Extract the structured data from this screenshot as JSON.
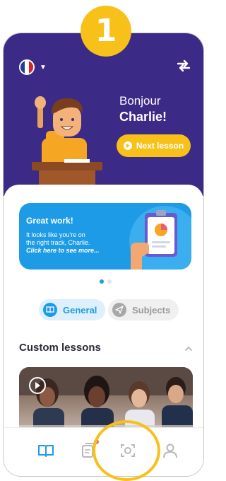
{
  "step_badge": "1",
  "header": {
    "language_flag": "france-flag-icon",
    "greeting": "Bonjour",
    "name": "Charlie!",
    "next_lesson_label": "Next lesson"
  },
  "banner": {
    "title": "Great work!",
    "line1": "It looks like you're on",
    "line2": "the right track, Charlie.",
    "line3": "Click here to see more..."
  },
  "carousel": {
    "pages": 2,
    "active": 1
  },
  "tabs": {
    "general_label": "General",
    "subjects_label": "Subjects",
    "selected": "General"
  },
  "section": {
    "title": "Custom lessons"
  },
  "bottom_nav": {
    "items": [
      "book-icon",
      "cards-icon",
      "scan-icon",
      "profile-icon"
    ],
    "highlighted": "scan-icon"
  },
  "colors": {
    "hero_bg": "#3B2A86",
    "accent_yellow": "#F7C11A",
    "accent_blue": "#1E9BE6"
  }
}
